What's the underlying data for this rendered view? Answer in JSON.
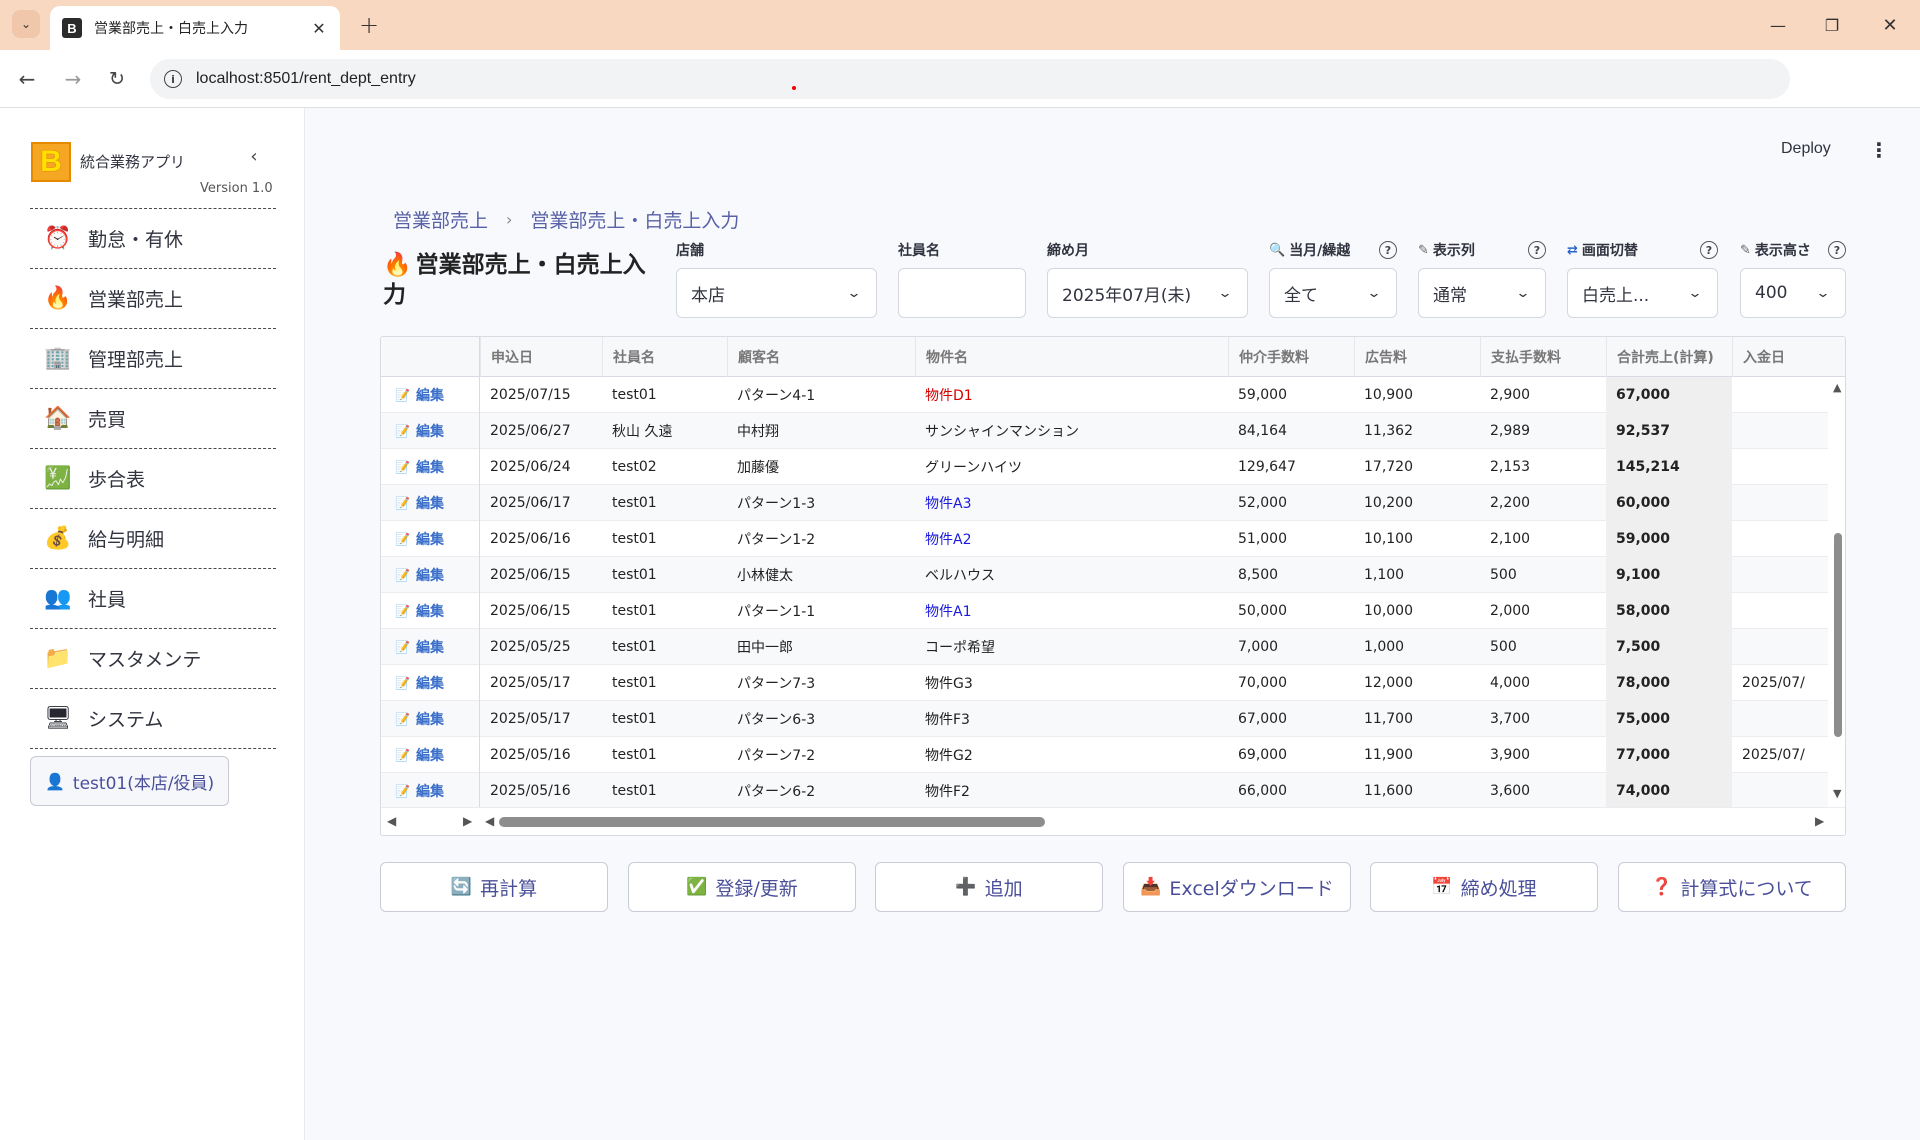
{
  "browser": {
    "tab_title": "営業部売上・白売上入力",
    "favicon_letter": "B",
    "url": "localhost:8501/rent_dept_entry"
  },
  "sidebar": {
    "app_logo_letter": "B",
    "app_name": "統合業務アプリ",
    "version": "Version 1.0",
    "items": [
      {
        "icon": "alarm-clock-icon",
        "glyph": "⏰",
        "label": "勤怠・有休"
      },
      {
        "icon": "fire-icon",
        "glyph": "🔥",
        "label": "営業部売上"
      },
      {
        "icon": "office-building-icon",
        "glyph": "🏢",
        "label": "管理部売上"
      },
      {
        "icon": "house-icon",
        "glyph": "🏠",
        "label": "売買"
      },
      {
        "icon": "chart-increasing-icon",
        "glyph": "💹",
        "label": "歩合表"
      },
      {
        "icon": "money-bag-icon",
        "glyph": "💰",
        "label": "給与明細"
      },
      {
        "icon": "people-icon",
        "glyph": "👥",
        "label": "社員"
      },
      {
        "icon": "folder-icon",
        "glyph": "📁",
        "label": "マスタメンテ"
      },
      {
        "icon": "computer-icon",
        "glyph": "🖥",
        "label": "システム"
      }
    ],
    "user_badge": "test01(本店/役員)"
  },
  "header": {
    "deploy_label": "Deploy"
  },
  "breadcrumb": {
    "parent": "営業部売上",
    "current": "営業部売上・白売上入力"
  },
  "page": {
    "title": "営業部売上・白売上入力"
  },
  "filters": {
    "store": {
      "label": "店舗",
      "value": "本店"
    },
    "employee": {
      "label": "社員名",
      "value": ""
    },
    "closing_month": {
      "label": "締め月",
      "value": "2025年07月(未)"
    },
    "month_carry": {
      "label": "当月/繰越",
      "value": "全て"
    },
    "columns": {
      "label": "表示列",
      "value": "通常"
    },
    "screen": {
      "label": "画面切替",
      "value": "白売上..."
    },
    "height": {
      "label": "表示高さ",
      "value": "400"
    }
  },
  "grid": {
    "columns": [
      "申込日",
      "社員名",
      "顧客名",
      "物件名",
      "仲介手数料",
      "広告料",
      "支払手数料",
      "合計売上(計算)",
      "入金日"
    ],
    "edit_label": "編集",
    "rows": [
      {
        "date": "2025/07/15",
        "employee": "test01",
        "customer": "パターン4-1",
        "property": "物件D1",
        "prop_color": "red",
        "broker_fee": "59,000",
        "ad_fee": "10,900",
        "pay_fee": "2,900",
        "total": "67,000",
        "paid_date": ""
      },
      {
        "date": "2025/06/27",
        "employee": "秋山 久遠",
        "customer": "中村翔",
        "property": "サンシャインマンション",
        "prop_color": "",
        "broker_fee": "84,164",
        "ad_fee": "11,362",
        "pay_fee": "2,989",
        "total": "92,537",
        "paid_date": ""
      },
      {
        "date": "2025/06/24",
        "employee": "test02",
        "customer": "加藤優",
        "property": "グリーンハイツ",
        "prop_color": "",
        "broker_fee": "129,647",
        "ad_fee": "17,720",
        "pay_fee": "2,153",
        "total": "145,214",
        "paid_date": ""
      },
      {
        "date": "2025/06/17",
        "employee": "test01",
        "customer": "パターン1-3",
        "property": "物件A3",
        "prop_color": "blue",
        "broker_fee": "52,000",
        "ad_fee": "10,200",
        "pay_fee": "2,200",
        "total": "60,000",
        "paid_date": ""
      },
      {
        "date": "2025/06/16",
        "employee": "test01",
        "customer": "パターン1-2",
        "property": "物件A2",
        "prop_color": "blue",
        "broker_fee": "51,000",
        "ad_fee": "10,100",
        "pay_fee": "2,100",
        "total": "59,000",
        "paid_date": ""
      },
      {
        "date": "2025/06/15",
        "employee": "test01",
        "customer": "小林健太",
        "property": "ベルハウス",
        "prop_color": "",
        "broker_fee": "8,500",
        "ad_fee": "1,100",
        "pay_fee": "500",
        "total": "9,100",
        "paid_date": ""
      },
      {
        "date": "2025/06/15",
        "employee": "test01",
        "customer": "パターン1-1",
        "property": "物件A1",
        "prop_color": "blue",
        "broker_fee": "50,000",
        "ad_fee": "10,000",
        "pay_fee": "2,000",
        "total": "58,000",
        "paid_date": ""
      },
      {
        "date": "2025/05/25",
        "employee": "test01",
        "customer": "田中一郎",
        "property": "コーポ希望",
        "prop_color": "",
        "broker_fee": "7,000",
        "ad_fee": "1,000",
        "pay_fee": "500",
        "total": "7,500",
        "paid_date": ""
      },
      {
        "date": "2025/05/17",
        "employee": "test01",
        "customer": "パターン7-3",
        "property": "物件G3",
        "prop_color": "",
        "broker_fee": "70,000",
        "ad_fee": "12,000",
        "pay_fee": "4,000",
        "total": "78,000",
        "paid_date": "2025/07/"
      },
      {
        "date": "2025/05/17",
        "employee": "test01",
        "customer": "パターン6-3",
        "property": "物件F3",
        "prop_color": "",
        "broker_fee": "67,000",
        "ad_fee": "11,700",
        "pay_fee": "3,700",
        "total": "75,000",
        "paid_date": ""
      },
      {
        "date": "2025/05/16",
        "employee": "test01",
        "customer": "パターン7-2",
        "property": "物件G2",
        "prop_color": "",
        "broker_fee": "69,000",
        "ad_fee": "11,900",
        "pay_fee": "3,900",
        "total": "77,000",
        "paid_date": "2025/07/"
      },
      {
        "date": "2025/05/16",
        "employee": "test01",
        "customer": "パターン6-2",
        "property": "物件F2",
        "prop_color": "",
        "broker_fee": "66,000",
        "ad_fee": "11,600",
        "pay_fee": "3,600",
        "total": "74,000",
        "paid_date": ""
      }
    ]
  },
  "actions": [
    {
      "name": "recalculate-button",
      "icon": "refresh-icon",
      "glyph": "🔄",
      "label": "再計算"
    },
    {
      "name": "register-update-button",
      "icon": "check-mark-icon",
      "glyph": "✅",
      "label": "登録/更新"
    },
    {
      "name": "add-button",
      "icon": "plus-icon",
      "glyph": "➕",
      "label": "追加"
    },
    {
      "name": "excel-download-button",
      "icon": "inbox-tray-icon",
      "glyph": "📥",
      "label": "Excelダウンロード"
    },
    {
      "name": "closing-process-button",
      "icon": "calendar-icon",
      "glyph": "📅",
      "label": "締め処理"
    },
    {
      "name": "formula-info-button",
      "icon": "question-icon",
      "glyph": "❓",
      "label": "計算式について"
    }
  ],
  "colors": {
    "accent": "#4a4f9a",
    "breadcrumb": "#5861a6",
    "chrome": "#f9d8c1"
  }
}
